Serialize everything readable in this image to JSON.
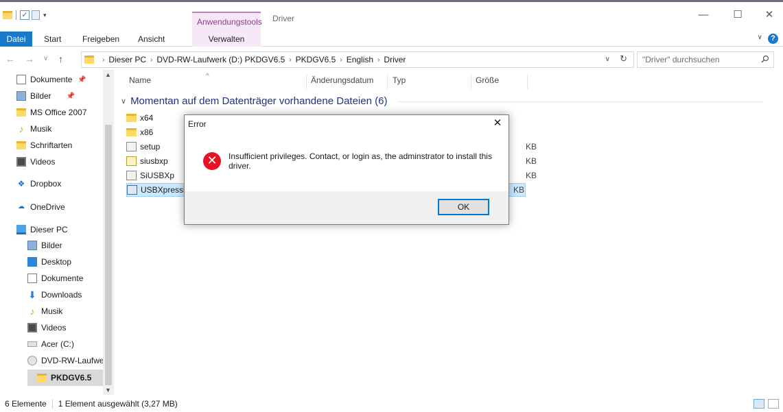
{
  "titlebar": {
    "contextual_tab": "Anwendungstools",
    "window_title": "Driver",
    "minimize": "—",
    "maximize": "☐",
    "close": "✕"
  },
  "ribbon": {
    "tabs": [
      "Datei",
      "Start",
      "Freigeben",
      "Ansicht",
      "Verwalten"
    ],
    "expand": "∨",
    "help": "?"
  },
  "address": {
    "back": "←",
    "forward": "→",
    "recent": "∨",
    "up": "↑",
    "crumbs": [
      "Dieser PC",
      "DVD-RW-Laufwerk (D:) PKDGV6.5",
      "PKDGV6.5",
      "English",
      "Driver"
    ],
    "dropdown": "∨",
    "refresh": "↻"
  },
  "search": {
    "placeholder": "\"Driver\" durchsuchen"
  },
  "nav": {
    "items": [
      {
        "label": "Dokumente",
        "icon": "document-icon",
        "pinned": true
      },
      {
        "label": "Bilder",
        "icon": "pictures-icon",
        "pinned": true
      },
      {
        "label": "MS Office 2007",
        "icon": "folder-icon"
      },
      {
        "label": "Musik",
        "icon": "music-icon"
      },
      {
        "label": "Schriftarten",
        "icon": "folder-icon"
      },
      {
        "label": "Videos",
        "icon": "videos-icon"
      },
      {
        "label": "Dropbox",
        "icon": "dropbox-icon"
      },
      {
        "label": "OneDrive",
        "icon": "onedrive-icon"
      },
      {
        "label": "Dieser PC",
        "icon": "computer-icon"
      },
      {
        "label": "Bilder",
        "icon": "pictures-icon"
      },
      {
        "label": "Desktop",
        "icon": "desktop-icon"
      },
      {
        "label": "Dokumente",
        "icon": "document-icon"
      },
      {
        "label": "Downloads",
        "icon": "downloads-icon"
      },
      {
        "label": "Musik",
        "icon": "music-icon"
      },
      {
        "label": "Videos",
        "icon": "videos-icon"
      },
      {
        "label": "Acer (C:)",
        "icon": "drive-icon"
      },
      {
        "label": "DVD-RW-Laufwe",
        "icon": "dvd-icon"
      },
      {
        "label": "PKDGV6.5",
        "icon": "folder-icon",
        "selected": true
      }
    ]
  },
  "files": {
    "columns": [
      "Name",
      "Änderungsdatum",
      "Typ",
      "Größe"
    ],
    "group_header": "Momentan auf dem Datenträger vorhandene Dateien (6)",
    "rows": [
      {
        "name": "x64",
        "icon": "folder-icon",
        "size": ""
      },
      {
        "name": "x86",
        "icon": "folder-icon",
        "size": ""
      },
      {
        "name": "setup",
        "icon": "setup-file-icon",
        "size": "KB"
      },
      {
        "name": "siusbxp",
        "icon": "inf-file-icon",
        "size": "KB"
      },
      {
        "name": "SiUSBXp",
        "icon": "sys-file-icon",
        "size": "KB"
      },
      {
        "name": "USBXpressl",
        "icon": "exe-file-icon",
        "size": "KB",
        "selected": true
      }
    ]
  },
  "status": {
    "count": "6 Elemente",
    "selection": "1 Element ausgewählt (3,27 MB)"
  },
  "dialog": {
    "title": "Error",
    "close": "✕",
    "message": "Insufficient privileges. Contact, or login as, the adminstrator to install this driver.",
    "ok": "OK"
  },
  "colors": {
    "file_tab": "#1979ca",
    "context_tab": "#f7e8f7",
    "group_header": "#1e3287",
    "selection": "#cce8ff",
    "error": "#e81123",
    "ok_border": "#0078d7"
  }
}
